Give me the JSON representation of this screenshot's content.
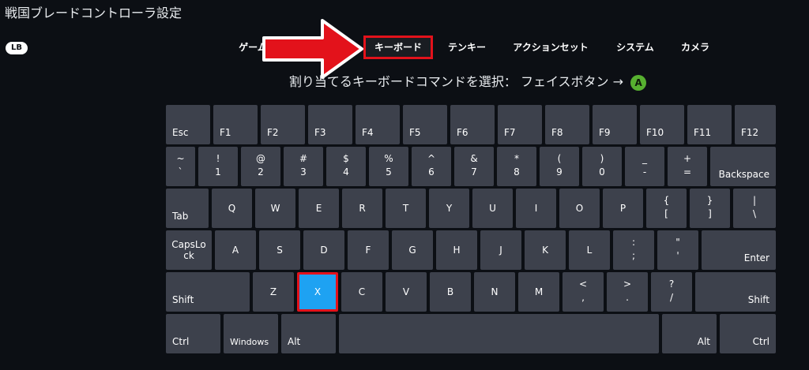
{
  "window": {
    "title": "戦国ブレードコントローラ設定"
  },
  "shoulder_hint": "LB",
  "tabs": [
    {
      "label": "ゲーム",
      "active": false
    },
    {
      "label": "キーボード",
      "active": true
    },
    {
      "label": "テンキー",
      "active": false
    },
    {
      "label": "アクションセット",
      "active": false
    },
    {
      "label": "システム",
      "active": false
    },
    {
      "label": "カメラ",
      "active": false
    }
  ],
  "prompt": {
    "text": "割り当てるキーボードコマンドを選択： フェイスボタン →",
    "button": "A"
  },
  "colors": {
    "accent": "#e3121b",
    "selected_key": "#1ea2f2",
    "key": "#3d414c",
    "face_a": "#57b030"
  },
  "keyboard": {
    "selected": "X",
    "rows": [
      [
        {
          "label": "Esc",
          "w": 1
        },
        {
          "label": "F1",
          "w": 1
        },
        {
          "label": "F2",
          "w": 1
        },
        {
          "label": "F3",
          "w": 1
        },
        {
          "label": "F4",
          "w": 1
        },
        {
          "label": "F5",
          "w": 1
        },
        {
          "label": "F6",
          "w": 1
        },
        {
          "label": "F7",
          "w": 1
        },
        {
          "label": "F8",
          "w": 1
        },
        {
          "label": "F9",
          "w": 1
        },
        {
          "label": "F10",
          "w": 1
        },
        {
          "label": "F11",
          "w": 1
        },
        {
          "label": "F12",
          "w": 1
        }
      ],
      [
        {
          "top": "~",
          "bottom": "`",
          "w": 0.75
        },
        {
          "top": "!",
          "bottom": "1",
          "w": 1
        },
        {
          "top": "@",
          "bottom": "2",
          "w": 1
        },
        {
          "top": "#",
          "bottom": "3",
          "w": 1
        },
        {
          "top": "$",
          "bottom": "4",
          "w": 1
        },
        {
          "top": "%",
          "bottom": "5",
          "w": 1
        },
        {
          "top": "^",
          "bottom": "6",
          "w": 1
        },
        {
          "top": "&",
          "bottom": "7",
          "w": 1
        },
        {
          "top": "*",
          "bottom": "8",
          "w": 1
        },
        {
          "top": "(",
          "bottom": "9",
          "w": 1
        },
        {
          "top": ")",
          "bottom": "0",
          "w": 1
        },
        {
          "top": "_",
          "bottom": "-",
          "w": 1
        },
        {
          "top": "+",
          "bottom": "=",
          "w": 1
        },
        {
          "label": "Backspace",
          "w": 1.75,
          "align": "right"
        }
      ],
      [
        {
          "label": "Tab",
          "w": 1.05
        },
        {
          "label": "Q",
          "w": 1,
          "center": true
        },
        {
          "label": "W",
          "w": 1,
          "center": true
        },
        {
          "label": "E",
          "w": 1,
          "center": true
        },
        {
          "label": "R",
          "w": 1,
          "center": true
        },
        {
          "label": "T",
          "w": 1,
          "center": true
        },
        {
          "label": "Y",
          "w": 1,
          "center": true
        },
        {
          "label": "U",
          "w": 1,
          "center": true
        },
        {
          "label": "I",
          "w": 1,
          "center": true
        },
        {
          "label": "O",
          "w": 1,
          "center": true
        },
        {
          "label": "P",
          "w": 1,
          "center": true
        },
        {
          "top": "{",
          "bottom": "[",
          "w": 1
        },
        {
          "top": "}",
          "bottom": "]",
          "w": 1
        },
        {
          "top": "|",
          "bottom": "\\",
          "w": 1.05
        }
      ],
      [
        {
          "label": "CapsLock",
          "w": 1.1,
          "center": true,
          "narrow": true
        },
        {
          "label": "A",
          "w": 1,
          "center": true
        },
        {
          "label": "S",
          "w": 1,
          "center": true
        },
        {
          "label": "D",
          "w": 1,
          "center": true
        },
        {
          "label": "F",
          "w": 1,
          "center": true
        },
        {
          "label": "G",
          "w": 1,
          "center": true
        },
        {
          "label": "H",
          "w": 1,
          "center": true
        },
        {
          "label": "J",
          "w": 1,
          "center": true
        },
        {
          "label": "K",
          "w": 1,
          "center": true
        },
        {
          "label": "L",
          "w": 1,
          "center": true
        },
        {
          "top": ":",
          "bottom": ";",
          "w": 1
        },
        {
          "top": "\"",
          "bottom": "'",
          "w": 1
        },
        {
          "label": "Enter",
          "w": 1.72,
          "align": "right"
        }
      ],
      [
        {
          "label": "Shift",
          "w": 2.05
        },
        {
          "label": "Z",
          "w": 1,
          "center": true
        },
        {
          "label": "X",
          "w": 1,
          "center": true
        },
        {
          "label": "C",
          "w": 1,
          "center": true
        },
        {
          "label": "V",
          "w": 1,
          "center": true
        },
        {
          "label": "B",
          "w": 1,
          "center": true
        },
        {
          "label": "N",
          "w": 1,
          "center": true
        },
        {
          "label": "M",
          "w": 1,
          "center": true
        },
        {
          "top": "<",
          "bottom": ",",
          "w": 1
        },
        {
          "top": ">",
          "bottom": ".",
          "w": 1
        },
        {
          "top": "?",
          "bottom": "/",
          "w": 1
        },
        {
          "label": "Shift",
          "w": 2.05,
          "align": "right"
        }
      ],
      [
        {
          "label": "Ctrl",
          "w": 1.25
        },
        {
          "label": "Windows",
          "w": 1.25,
          "small": true
        },
        {
          "label": "Alt",
          "w": 1.25
        },
        {
          "label": "",
          "w": 7.3
        },
        {
          "label": "Alt",
          "w": 1.25,
          "align": "right"
        },
        {
          "label": "Ctrl",
          "w": 1.25,
          "align": "right"
        }
      ]
    ]
  }
}
